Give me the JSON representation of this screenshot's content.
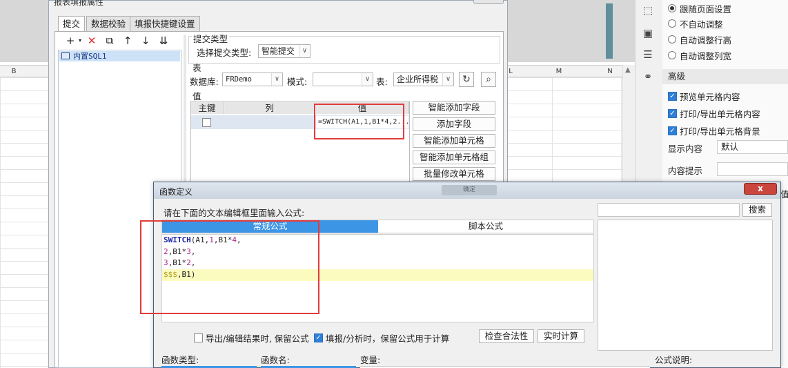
{
  "spreadsheet": {
    "columns": [
      "B",
      "L",
      "M",
      "N"
    ]
  },
  "right_panel": {
    "radio_options": [
      {
        "label": "跟随页面设置",
        "selected": true
      },
      {
        "label": "不自动调整",
        "selected": false
      },
      {
        "label": "自动调整行高",
        "selected": false
      },
      {
        "label": "自动调整列宽",
        "selected": false
      }
    ],
    "advanced_title": "高级",
    "checkboxes": [
      {
        "label": "预览单元格内容",
        "checked": true
      },
      {
        "label": "打印/导出单元格内容",
        "checked": true
      },
      {
        "label": "打印/导出单元格背景",
        "checked": true
      }
    ],
    "display_content_label": "显示内容",
    "display_content_value": "默认",
    "content_tip_label": "内容提示",
    "content_tip_value": "",
    "partial_label": "值"
  },
  "report_dialog": {
    "title": "报表填报属性",
    "tabs": [
      "提交",
      "数据校验",
      "填报快捷键设置"
    ],
    "tree_item": "内置SQL1",
    "submit_type_group": "提交类型",
    "select_type_label": "选择提交类型:",
    "select_type_value": "智能提交",
    "table_group": "表",
    "database_label": "数据库:",
    "database_value": "FRDemo",
    "mode_label": "模式:",
    "mode_value": "",
    "table_label": "表:",
    "table_value": "企业所得税",
    "value_group": "值",
    "columns": [
      "主键",
      "列",
      "值"
    ],
    "row": {
      "primary_key": false,
      "column": "",
      "value": "=SWITCH(A1,1,B1*4,2..."
    },
    "side_buttons": [
      "智能添加字段",
      "添加字段",
      "智能添加单元格",
      "智能添加单元格组",
      "批量修改单元格"
    ]
  },
  "formula_dialog": {
    "title": "函数定义",
    "ghost_button": "确定",
    "close_label": "x",
    "prompt": "请在下面的文本编辑框里面输入公式:",
    "search_value": "",
    "search_button": "搜索",
    "tab_normal": "常规公式",
    "tab_script": "脚本公式",
    "code_lines": [
      [
        {
          "t": "SWITCH",
          "c": "kw"
        },
        {
          "t": "(A1,",
          "c": ""
        },
        {
          "t": "1",
          "c": "num"
        },
        {
          "t": ",B1*",
          "c": ""
        },
        {
          "t": "4",
          "c": "num"
        },
        {
          "t": ",",
          "c": ""
        }
      ],
      [
        {
          "t": "2",
          "c": "num"
        },
        {
          "t": ",B1*",
          "c": ""
        },
        {
          "t": "3",
          "c": "num"
        },
        {
          "t": ",",
          "c": ""
        }
      ],
      [
        {
          "t": "3",
          "c": "num"
        },
        {
          "t": ",B1*",
          "c": ""
        },
        {
          "t": "2",
          "c": "num"
        },
        {
          "t": ",",
          "c": ""
        }
      ],
      [
        {
          "t": "$$$",
          "c": "dlr"
        },
        {
          "t": ",B1)",
          "c": ""
        }
      ]
    ],
    "opt_export": {
      "label": "导出/编辑结果时, 保留公式",
      "checked": false
    },
    "opt_fill": {
      "label": "填报/分析时，保留公式用于计算",
      "checked": true
    },
    "check_button": "检查合法性",
    "realtime_button": "实时计算",
    "func_type_label": "函数类型:",
    "func_name_label": "函数名:",
    "variable_label": "变量:",
    "formula_desc_label": "公式说明:"
  },
  "colors": {
    "accent": "#3d95e6",
    "highlight_box": "#e23b3b",
    "editor_highlight": "#fbfbbf"
  }
}
